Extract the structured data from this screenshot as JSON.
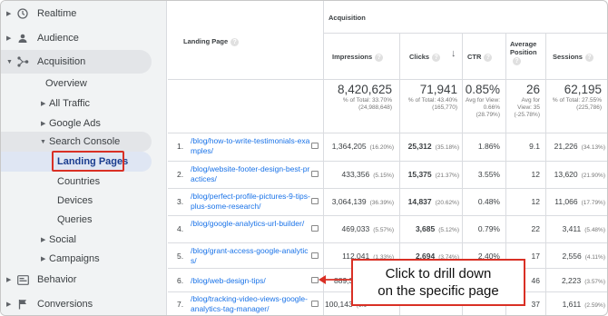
{
  "sidebar": {
    "realtime": "Realtime",
    "audience": "Audience",
    "acquisition": "Acquisition",
    "overview": "Overview",
    "all_traffic": "All Traffic",
    "google_ads": "Google Ads",
    "search_console": "Search Console",
    "landing_pages": "Landing Pages",
    "countries": "Countries",
    "devices": "Devices",
    "queries": "Queries",
    "social": "Social",
    "campaigns": "Campaigns",
    "behavior": "Behavior",
    "conversions": "Conversions"
  },
  "table": {
    "group_header": "Acquisition",
    "col_landing_page": "Landing Page",
    "col_impressions": "Impressions",
    "col_clicks": "Clicks",
    "col_ctr": "CTR",
    "col_avg_position": "Average Position",
    "col_sessions": "Sessions",
    "totals": {
      "impressions": "8,420,625",
      "impressions_sub": "% of Total: 33.70% (24,988,648)",
      "clicks": "71,941",
      "clicks_sub": "% of Total: 43.40% (165,770)",
      "ctr": "0.85%",
      "ctr_sub": "Avg for View: 0.66% (28.79%)",
      "position": "26",
      "position_sub": "Avg for View: 35 (-25.78%)",
      "sessions": "62,195",
      "sessions_sub": "% of Total: 27.55% (225,786)"
    },
    "rows": [
      {
        "num": "1.",
        "page": "/blog/how-to-write-testimonials-examples/",
        "impr": "1,364,205",
        "impr_pct": "(16.20%)",
        "clicks": "25,312",
        "clicks_pct": "(35.18%)",
        "ctr": "1.86%",
        "pos": "9.1",
        "sess": "21,226",
        "sess_pct": "(34.13%)"
      },
      {
        "num": "2.",
        "page": "/blog/website-footer-design-best-practices/",
        "impr": "433,356",
        "impr_pct": "(5.15%)",
        "clicks": "15,375",
        "clicks_pct": "(21.37%)",
        "ctr": "3.55%",
        "pos": "12",
        "sess": "13,620",
        "sess_pct": "(21.90%)"
      },
      {
        "num": "3.",
        "page": "/blog/perfect-profile-pictures-9-tips-plus-some-research/",
        "impr": "3,064,139",
        "impr_pct": "(36.39%)",
        "clicks": "14,837",
        "clicks_pct": "(20.62%)",
        "ctr": "0.48%",
        "pos": "12",
        "sess": "11,066",
        "sess_pct": "(17.79%)"
      },
      {
        "num": "4.",
        "page": "/blog/google-analytics-url-builder/",
        "impr": "469,033",
        "impr_pct": "(5.57%)",
        "clicks": "3,685",
        "clicks_pct": "(5.12%)",
        "ctr": "0.79%",
        "pos": "22",
        "sess": "3,411",
        "sess_pct": "(5.48%)"
      },
      {
        "num": "5.",
        "page": "/blog/grant-access-google-analytics/",
        "impr": "112,041",
        "impr_pct": "(1.33%)",
        "clicks": "2,694",
        "clicks_pct": "(3.74%)",
        "ctr": "2.40%",
        "pos": "17",
        "sess": "2,556",
        "sess_pct": "(4.11%)"
      },
      {
        "num": "6.",
        "page": "/blog/web-design-tips/",
        "impr": "889,3",
        "impr_pct": "",
        "clicks": "",
        "clicks_pct": "",
        "ctr": "",
        "pos": "46",
        "sess": "2,223",
        "sess_pct": "(3.57%)"
      },
      {
        "num": "7.",
        "page": "/blog/tracking-video-views-google-analytics-tag-manager/",
        "impr": "100,143",
        "impr_pct": "(1.1",
        "clicks": "",
        "clicks_pct": "",
        "ctr": "",
        "pos": "37",
        "sess": "1,611",
        "sess_pct": "(2.59%)"
      }
    ]
  },
  "callout": {
    "line1": "Click to drill down",
    "line2": "on the specific page"
  },
  "colors": {
    "link": "#1a73e8",
    "highlight_border": "#d93025",
    "sidebar_bg": "#f1f3f4"
  }
}
